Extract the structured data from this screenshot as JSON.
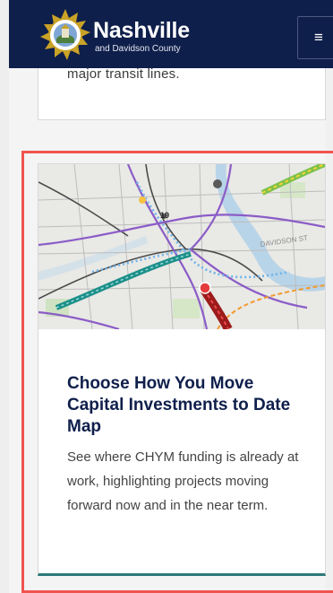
{
  "header": {
    "brand_name": "Nashville",
    "brand_sub": "and Davidson County",
    "menu_glyph": "≡",
    "colors": {
      "background": "#0f1f4b",
      "text": "#ffffff",
      "seal_gold": "#c9a227"
    }
  },
  "previous_card": {
    "text_fragment": "major transit lines."
  },
  "feature_card": {
    "title": "Choose How You Move Capital Investments to Date Map",
    "description": "See where CHYM funding is already at work, highlighting projects moving forward now and in the near term.",
    "map_labels": {
      "district": "DAVIDSON ST",
      "route_number": "19"
    },
    "colors": {
      "highlight_border": "#f0544f",
      "accent_bottom": "#2b7a78",
      "title": "#0f1f4b"
    }
  }
}
